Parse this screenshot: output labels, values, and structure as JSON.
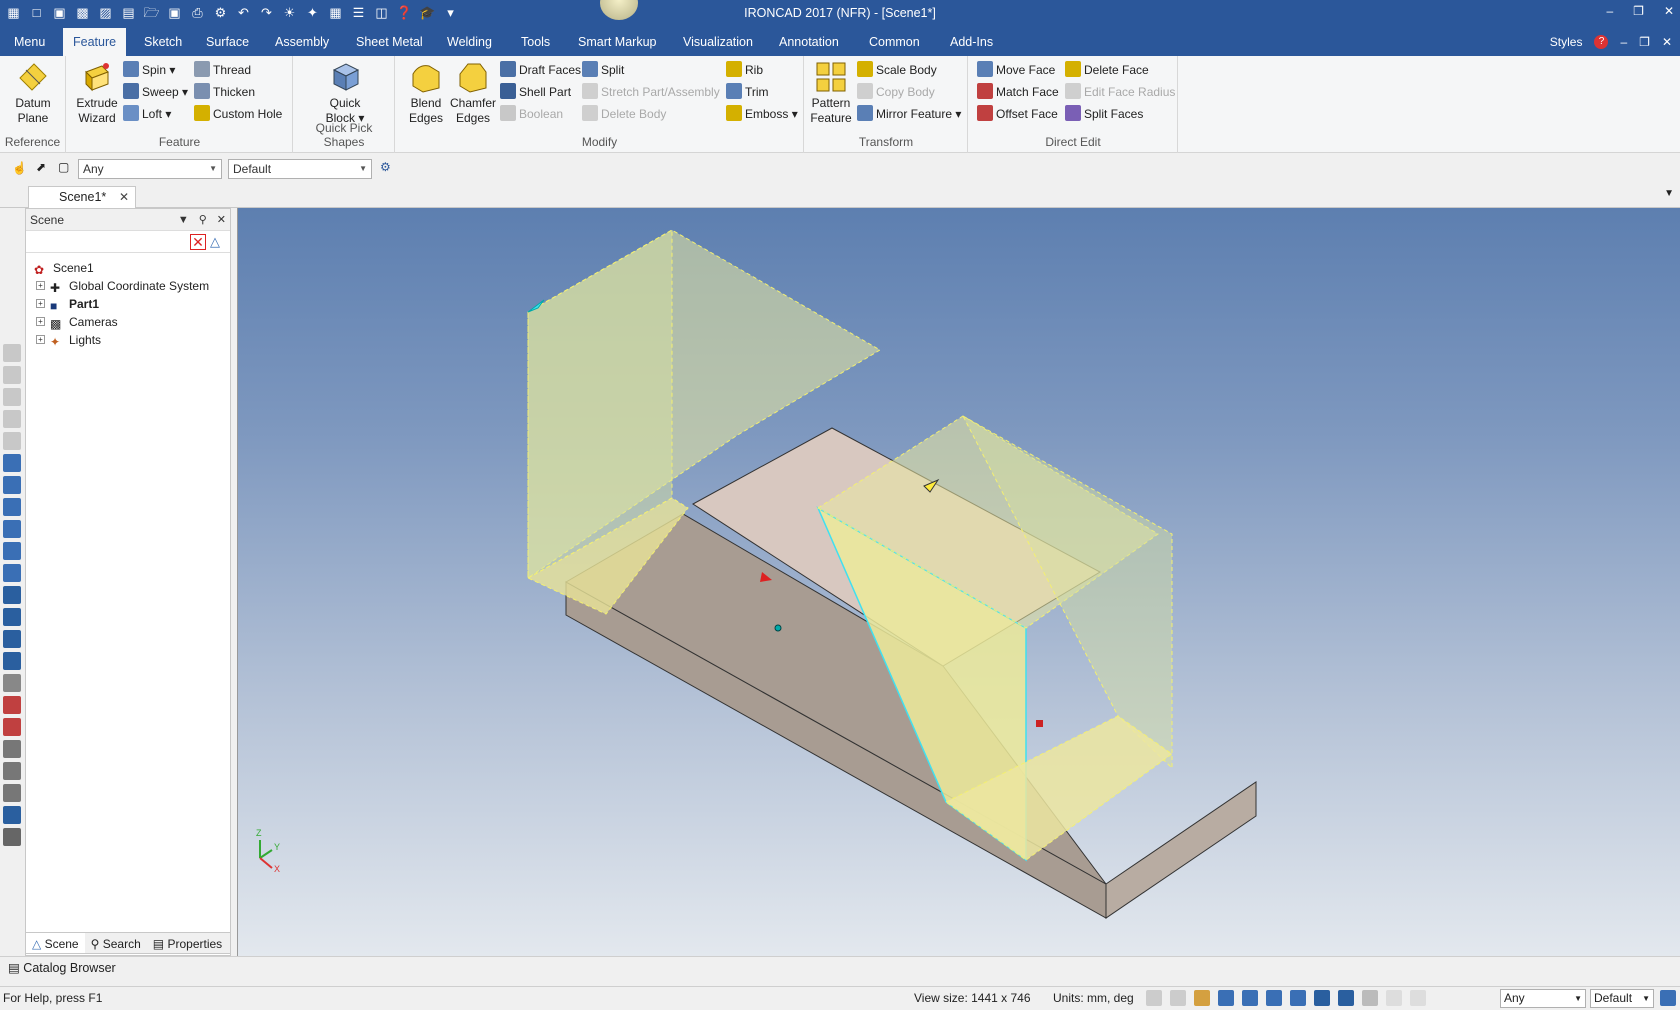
{
  "window": {
    "title": "IRONCAD 2017 (NFR) - [Scene1*]",
    "controls": [
      "–",
      "❐",
      "✕"
    ]
  },
  "tabs": [
    "Menu",
    "Feature",
    "Sketch",
    "Surface",
    "Assembly",
    "Sheet Metal",
    "Welding",
    "Tools",
    "Smart Markup",
    "Visualization",
    "Annotation",
    "Common",
    "Add-Ins"
  ],
  "active_tab": "Feature",
  "tabs_right": {
    "styles": "Styles",
    "help": "?",
    "controls": [
      "–",
      "❐",
      "✕"
    ]
  },
  "ribbon": {
    "reference": {
      "label": "Reference",
      "datum_plane": "Datum Plane"
    },
    "feature": {
      "label": "Feature",
      "extrude_wizard": "Extrude Wizard",
      "spin": "Spin",
      "sweep": "Sweep",
      "loft": "Loft",
      "thread": "Thread",
      "thicken": "Thicken",
      "custom_hole": "Custom Hole"
    },
    "quick_pick": {
      "label": "Quick Pick Shapes",
      "quick_block": "Quick Block"
    },
    "modify": {
      "label": "Modify",
      "blend_edges": "Blend Edges",
      "chamfer_edges": "Chamfer Edges",
      "draft_faces": "Draft Faces",
      "shell_part": "Shell Part",
      "boolean": "Boolean",
      "split": "Split",
      "stretch_part": "Stretch Part/Assembly",
      "delete_body": "Delete Body",
      "rib": "Rib",
      "trim": "Trim",
      "emboss": "Emboss"
    },
    "transform": {
      "label": "Transform",
      "pattern_feature": "Pattern Feature",
      "scale_body": "Scale Body",
      "copy_body": "Copy Body",
      "mirror_feature": "Mirror Feature"
    },
    "direct_edit": {
      "label": "Direct Edit",
      "move_face": "Move Face",
      "match_face": "Match Face",
      "offset_face": "Offset Face",
      "delete_face": "Delete Face",
      "edit_face_radius": "Edit Face Radius",
      "split_faces": "Split Faces"
    }
  },
  "selection": {
    "filter": "Any",
    "style": "Default"
  },
  "document_tab": "Scene1*",
  "scene_panel": {
    "title": "Scene",
    "tree": [
      {
        "label": "Scene1",
        "bold": false
      },
      {
        "label": "Global Coordinate System",
        "bold": false
      },
      {
        "label": "Part1",
        "bold": true
      },
      {
        "label": "Cameras",
        "bold": false
      },
      {
        "label": "Lights",
        "bold": false
      }
    ],
    "tabs": [
      "Scene",
      "Search",
      "Properties"
    ]
  },
  "triad": {
    "z": "Z",
    "y": "Y",
    "x": "X"
  },
  "catalog_browser": "Catalog Browser",
  "status": {
    "help": "For Help, press F1",
    "view_size": "View size: 1441 x  746",
    "units": "Units: mm, deg",
    "filter": "Any",
    "style": "Default"
  },
  "colors": {
    "title_bar": "#2b579a",
    "ribbon": "#f5f6f7",
    "part_body": "#a89c92",
    "part_top": "#d8c8c0",
    "feature_yellow": "#e8e8a0",
    "highlight_cyan": "#40e0f0"
  }
}
